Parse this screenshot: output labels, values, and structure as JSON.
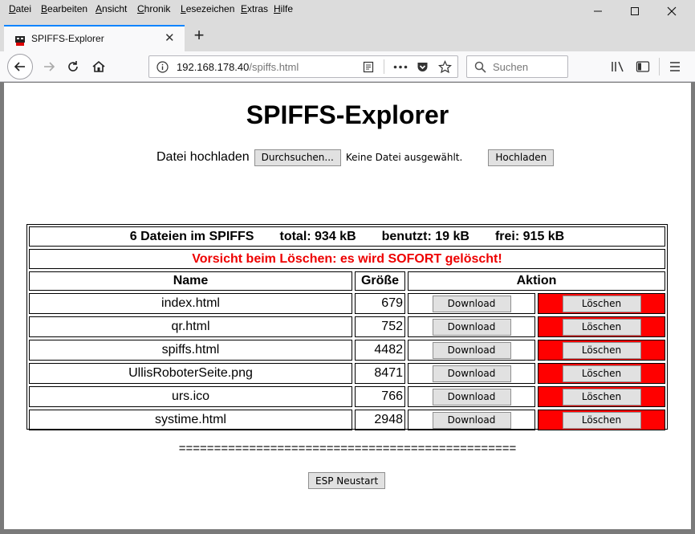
{
  "menu": [
    {
      "acc": "D",
      "rest": "atei"
    },
    {
      "acc": "B",
      "rest": "earbeiten"
    },
    {
      "acc": "A",
      "rest": "nsicht"
    },
    {
      "acc": "C",
      "rest": "hronik"
    },
    {
      "acc": "L",
      "rest": "esezeichen"
    },
    {
      "acc": "E",
      "rest": "xtras"
    },
    {
      "acc": "H",
      "rest": "ilfe"
    }
  ],
  "window_controls": {
    "minimize": "—",
    "maximize": "☐",
    "close": "✕"
  },
  "tab": {
    "title": "SPIFFS-Explorer",
    "close": "✕",
    "new": "+"
  },
  "address": {
    "host": "192.168.178.40",
    "path": "/spiffs.html"
  },
  "search": {
    "placeholder": "Suchen"
  },
  "page": {
    "title": "SPIFFS-Explorer",
    "upload_label": "Datei hochladen",
    "browse_label": "Durchsuchen...",
    "no_file": "Keine Datei ausgewählt.",
    "upload_button": "Hochladen",
    "summary": {
      "count": "6 Dateien im SPIFFS",
      "total": "total: 934 kB",
      "used": "benutzt: 19 kB",
      "free": "frei: 915 kB"
    },
    "warning": "Vorsicht beim Löschen: es wird SOFORT gelöscht!",
    "columns": {
      "name": "Name",
      "size": "Größe",
      "action": "Aktion"
    },
    "download_label": "Download",
    "delete_label": "Löschen",
    "files": [
      {
        "name": "index.html",
        "size": "679"
      },
      {
        "name": "qr.html",
        "size": "752"
      },
      {
        "name": "spiffs.html",
        "size": "4482"
      },
      {
        "name": "UllisRoboterSeite.png",
        "size": "8471"
      },
      {
        "name": "urs.ico",
        "size": "766"
      },
      {
        "name": "systime.html",
        "size": "2948"
      }
    ],
    "separator": "================================================",
    "restart_button": "ESP  Neustart"
  },
  "colors": {
    "delete_bg": "#ff0000",
    "warning_text": "#ee0000",
    "tab_accent": "#0a84ff"
  }
}
